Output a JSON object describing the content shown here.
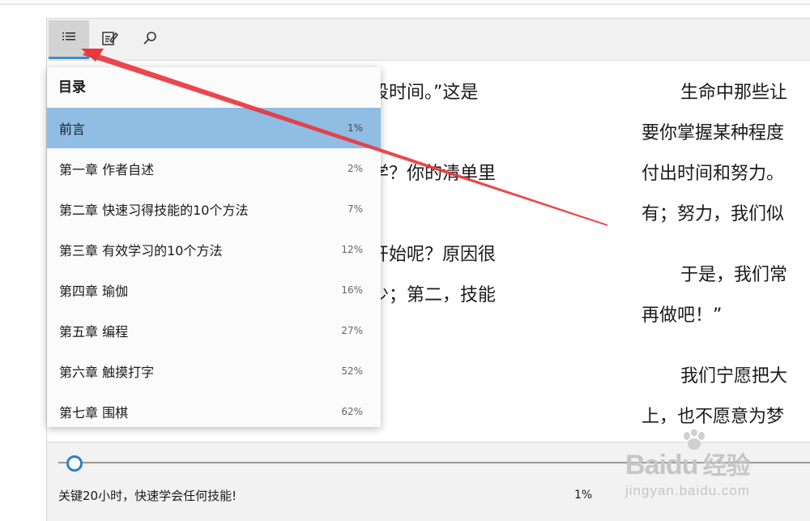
{
  "toolbar": {
    "buttons": [
      {
        "name": "toc-list-icon",
        "active": true
      },
      {
        "name": "notes-edit-icon",
        "active": false
      },
      {
        "name": "search-icon",
        "active": false
      }
    ]
  },
  "reader": {
    "left_lines": [
      "段时间。”这是",
      "",
      "学？你的清单里",
      "",
      "开始呢？原因很",
      "少；第二，技能"
    ],
    "right_lines": [
      "生命中那些让",
      "要你掌握某种程度",
      "付出时间和努力。",
      "有；努力，我们似",
      "",
      "于是，我们常",
      "再做吧！”",
      "",
      "我们宁愿把大",
      "上，也不愿意为梦"
    ]
  },
  "toc": {
    "title": "目录",
    "items": [
      {
        "label": "前言",
        "pct": "1%",
        "selected": true
      },
      {
        "label": "第一章 作者自述",
        "pct": "2%"
      },
      {
        "label": "第二章 快速习得技能的10个方法",
        "pct": "7%"
      },
      {
        "label": "第三章 有效学习的10个方法",
        "pct": "12%"
      },
      {
        "label": "第四章 瑜伽",
        "pct": "16%"
      },
      {
        "label": "第五章 编程",
        "pct": "27%"
      },
      {
        "label": "第六章 触摸打字",
        "pct": "52%"
      },
      {
        "label": "第七章 围棋",
        "pct": "62%"
      }
    ]
  },
  "bottom": {
    "book_title": "关键20小时，快速学会任何技能!",
    "progress_text": "1%",
    "progress_value": 0.01
  },
  "annotation": {
    "color": "#e8373d"
  },
  "watermark": {
    "logo": "Baidu",
    "logo_cn": "经验",
    "url": "jingyan.baidu.com"
  }
}
